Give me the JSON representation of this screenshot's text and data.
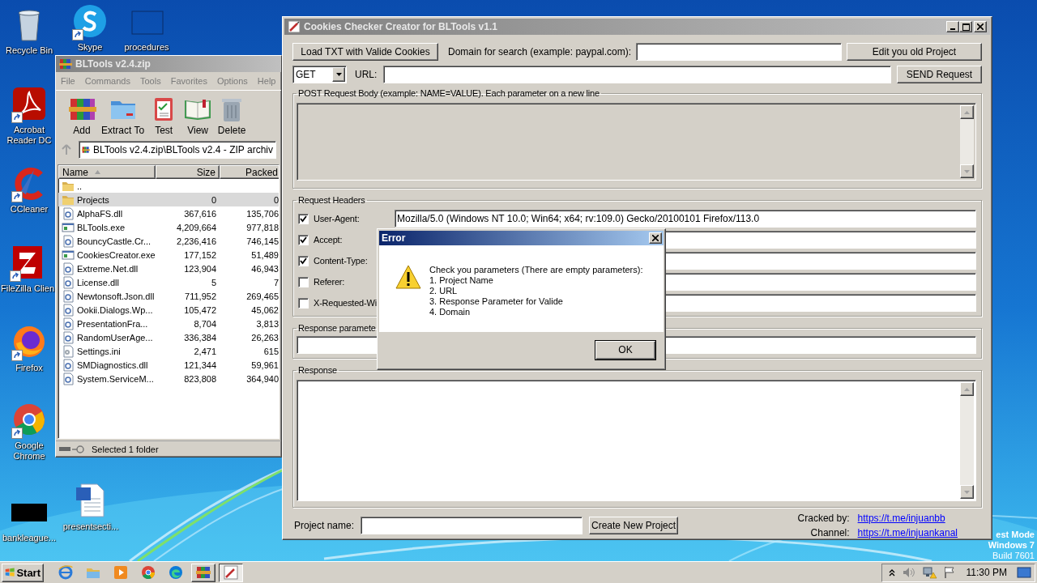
{
  "desktop_icons": [
    {
      "label": "Recycle Bin",
      "kind": "recycle",
      "shortcut": false
    },
    {
      "label": "Skype",
      "kind": "skype",
      "shortcut": true
    },
    {
      "label": "procedures",
      "kind": "blank",
      "shortcut": false
    },
    {
      "label": "Acrobat Reader DC",
      "kind": "acrobat",
      "shortcut": true
    },
    {
      "label": "CCleaner",
      "kind": "ccleaner",
      "shortcut": true
    },
    {
      "label": "FileZilla Clien",
      "kind": "filezilla",
      "shortcut": true
    },
    {
      "label": "Firefox",
      "kind": "firefox",
      "shortcut": true
    },
    {
      "label": "Google Chrome",
      "kind": "chrome",
      "shortcut": true
    },
    {
      "label": "bankleague...",
      "kind": "thumb",
      "shortcut": false
    },
    {
      "label": "presentsecti...",
      "kind": "word",
      "shortcut": false
    }
  ],
  "system_text": [
    "est Mode",
    "Windows 7",
    "Build 7601"
  ],
  "archive_window": {
    "title": "BLTools v2.4.zip",
    "menu": [
      "File",
      "Commands",
      "Tools",
      "Favorites",
      "Options",
      "Help"
    ],
    "toolbar": [
      {
        "label": "Add",
        "kind": "add"
      },
      {
        "label": "Extract To",
        "kind": "extract"
      },
      {
        "label": "Test",
        "kind": "test"
      },
      {
        "label": "View",
        "kind": "view"
      },
      {
        "label": "Delete",
        "kind": "delete"
      }
    ],
    "path": "BLTools v2.4.zip\\BLTools v2.4 - ZIP archiv",
    "columns": [
      "Name",
      "Size",
      "Packed"
    ],
    "rows": [
      {
        "name": "..",
        "kind": "folder",
        "selected": false
      },
      {
        "name": "Projects",
        "size": "0",
        "packed": "0",
        "kind": "folder",
        "selected": true
      },
      {
        "name": "AlphaFS.dll",
        "size": "367,616",
        "packed": "135,706",
        "kind": "dll",
        "selected": false
      },
      {
        "name": "BLTools.exe",
        "size": "4,209,664",
        "packed": "977,818",
        "kind": "exe",
        "selected": false
      },
      {
        "name": "BouncyCastle.Cr...",
        "size": "2,236,416",
        "packed": "746,145",
        "kind": "dll",
        "selected": false
      },
      {
        "name": "CookiesCreator.exe",
        "size": "177,152",
        "packed": "51,489",
        "kind": "exe",
        "selected": false
      },
      {
        "name": "Extreme.Net.dll",
        "size": "123,904",
        "packed": "46,943",
        "kind": "dll",
        "selected": false
      },
      {
        "name": "License.dll",
        "size": "5",
        "packed": "7",
        "kind": "dll",
        "selected": false
      },
      {
        "name": "Newtonsoft.Json.dll",
        "size": "711,952",
        "packed": "269,465",
        "kind": "dll",
        "selected": false
      },
      {
        "name": "Ookii.Dialogs.Wp...",
        "size": "105,472",
        "packed": "45,062",
        "kind": "dll",
        "selected": false
      },
      {
        "name": "PresentationFra...",
        "size": "8,704",
        "packed": "3,813",
        "kind": "dll",
        "selected": false
      },
      {
        "name": "RandomUserAge...",
        "size": "336,384",
        "packed": "26,263",
        "kind": "dll",
        "selected": false
      },
      {
        "name": "Settings.ini",
        "size": "2,471",
        "packed": "615",
        "kind": "ini",
        "selected": false
      },
      {
        "name": "SMDiagnostics.dll",
        "size": "121,344",
        "packed": "59,961",
        "kind": "dll",
        "selected": false
      },
      {
        "name": "System.ServiceM...",
        "size": "823,808",
        "packed": "364,940",
        "kind": "dll",
        "selected": false
      }
    ],
    "status": "Selected 1 folder"
  },
  "app_window": {
    "title": "Cookies Checker Creator for BLTools v1.1",
    "load_button": "Load TXT with Valide Cookies",
    "domain_label": "Domain for search (example: paypal.com):",
    "edit_button": "Edit you old Project",
    "method": "GET",
    "url_label": "URL:",
    "send_button": "SEND Request",
    "post_body": {
      "legend": "POST Request Body (example: NAME=VALUE). Each parameter on a new line",
      "disabled": true
    },
    "headers": {
      "legend": "Request Headers",
      "rows": [
        {
          "label": "User-Agent:",
          "checked": true,
          "value": "Mozilla/5.0 (Windows NT 10.0; Win64; x64; rv:109.0) Gecko/20100101 Firefox/113.0"
        },
        {
          "label": "Accept:",
          "checked": true
        },
        {
          "label": "Content-Type:",
          "checked": true
        },
        {
          "label": "Referer:",
          "checked": false
        },
        {
          "label": "X-Requested-Wi",
          "checked": false
        }
      ]
    },
    "response_parameter": {
      "legend": "Response paramete"
    },
    "response": {
      "legend": "Response"
    },
    "project_label": "Project name:",
    "create_button": "Create New Project",
    "credits": [
      {
        "label": "Cracked by:",
        "link": "https://t.me/injuanbb"
      },
      {
        "label": "Channel:",
        "link": "https://t.me/injuankanal"
      }
    ]
  },
  "error_dialog": {
    "title": "Error",
    "message": "Check you parameters (There are empty parameters):\n1. Project Name\n2. URL\n3. Response Parameter for Valide\n4. Domain",
    "button": "OK"
  },
  "taskbar": {
    "start": "Start",
    "apps": [
      {
        "kind": "ie",
        "open": false,
        "selected": false
      },
      {
        "kind": "explorer",
        "open": false,
        "selected": false
      },
      {
        "kind": "media",
        "open": false,
        "selected": false
      },
      {
        "kind": "chrome",
        "open": false,
        "selected": false
      },
      {
        "kind": "edge",
        "open": false,
        "selected": false
      },
      {
        "kind": "winrar",
        "open": true,
        "selected": false
      },
      {
        "kind": "pen",
        "open": true,
        "selected": true
      }
    ],
    "clock": "11:30 PM"
  }
}
